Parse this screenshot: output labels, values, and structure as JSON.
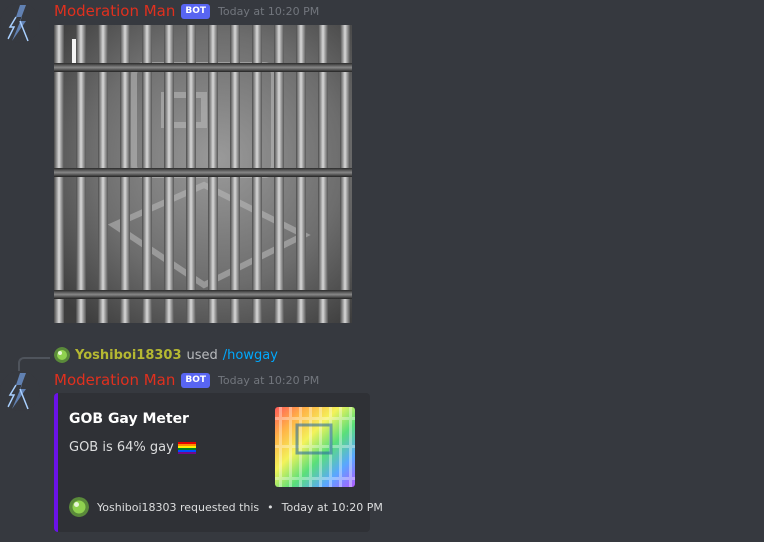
{
  "messages": [
    {
      "username": "Moderation Man",
      "bot_tag": "BOT",
      "timestamp": "Today at 10:20 PM"
    },
    {
      "username": "Moderation Man",
      "bot_tag": "BOT",
      "timestamp": "Today at 10:20 PM"
    }
  ],
  "reply": {
    "user": "Yoshiboi18303",
    "used": "used",
    "command": "/howgay"
  },
  "embed": {
    "title": "GOB Gay Meter",
    "description": "GOB is 64% gay",
    "footer": {
      "text": "Yoshiboi18303 requested this",
      "separator": "•",
      "time": "Today at 10:20 PM"
    }
  },
  "colors": {
    "background": "#36393f",
    "embed_background": "#2f3136",
    "embed_accent": "#6a12e8",
    "bot_username": "#e0301e",
    "reply_username": "#b5b832",
    "bot_tag": "#5865f2",
    "link": "#00a8fc"
  },
  "icons": {
    "bot_avatar": "lightning-figure-icon",
    "user_avatar": "yoshi-icon",
    "flag": "rainbow-flag-icon"
  }
}
